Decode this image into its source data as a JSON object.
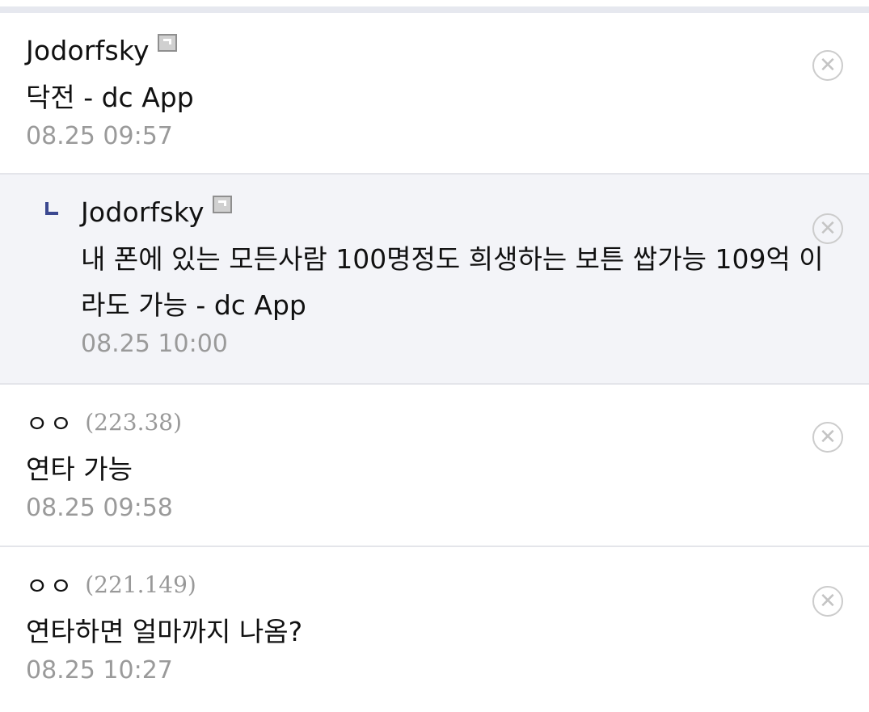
{
  "comments": [
    {
      "author": "Jodorfsky",
      "author_icon": "gallog-icon",
      "content": "닥전 - dc App",
      "date": "08.25 09:57",
      "delete_icon": "close-circle-icon"
    },
    {
      "author": "Jodorfsky",
      "author_icon": "gallog-icon",
      "reply_icon": "reply-arrow-icon",
      "content": "내 폰에 있는 모든사람 100명정도 희생하는 보튼 쌉가능 109억 이라도 가능 - dc App",
      "date": "08.25 10:00",
      "delete_icon": "close-circle-icon"
    },
    {
      "author": "ㅇㅇ",
      "ip": "(223.38)",
      "content": "연타 가능",
      "date": "08.25 09:58",
      "delete_icon": "close-circle-icon"
    },
    {
      "author": "ㅇㅇ",
      "ip": "(221.149)",
      "content": "연타하면 얼마까지 나옴?",
      "date": "08.25 10:27",
      "delete_icon": "close-circle-icon"
    }
  ],
  "colors": {
    "reply_background": "#f3f4f8",
    "reply_mark": "#3b4890",
    "date_text": "#9a9a9a",
    "divider": "#e4e5ea"
  }
}
